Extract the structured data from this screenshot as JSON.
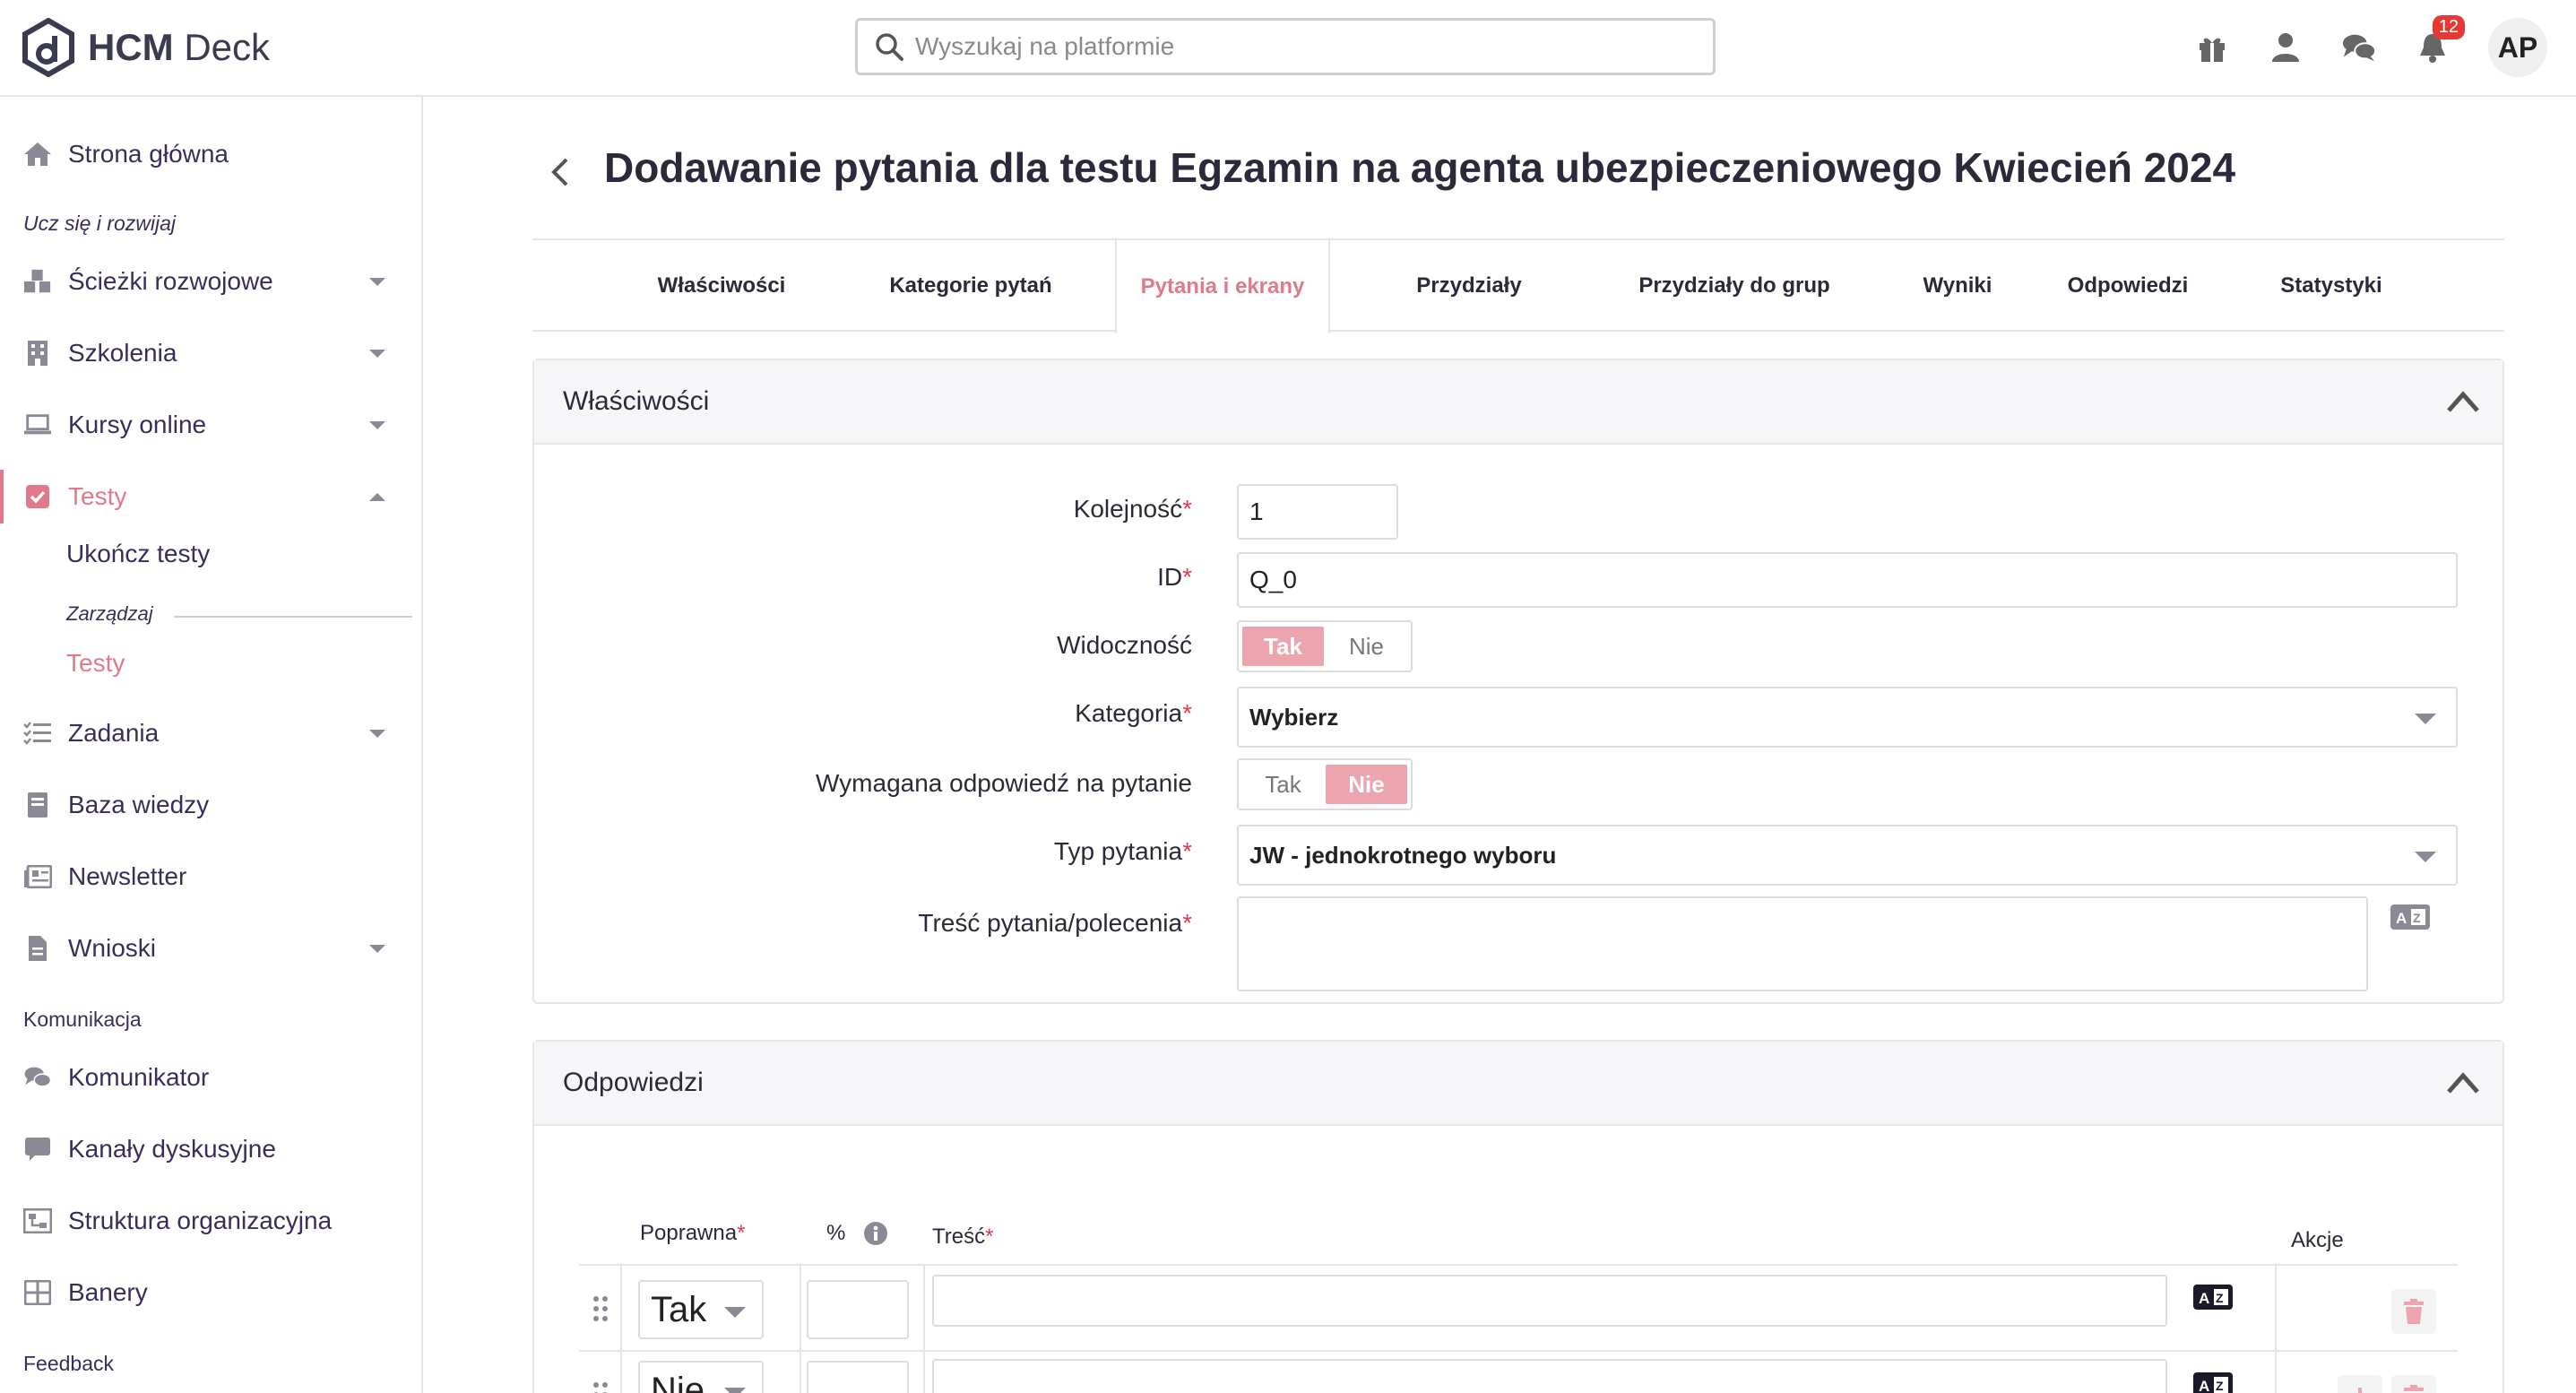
{
  "app": {
    "logo_text": "HCM",
    "logo_text2": "Deck"
  },
  "search": {
    "placeholder": "Wyszukaj na platformie"
  },
  "topbar": {
    "notifications_count": "12",
    "avatar_initials": "AP"
  },
  "sidebar": {
    "home": "Strona główna",
    "section_learn": "Ucz się i rozwijaj",
    "paths": "Ścieżki rozwojowe",
    "trainings": "Szkolenia",
    "courses": "Kursy online",
    "tests": "Testy",
    "tests_complete": "Ukończ testy",
    "tests_manage_label": "Zarządzaj",
    "tests_manage_item": "Testy",
    "tasks": "Zadania",
    "knowledge": "Baza wiedzy",
    "newsletter": "Newsletter",
    "requests": "Wnioski",
    "section_comm": "Komunikacja",
    "messenger": "Komunikator",
    "channels": "Kanały dyskusyjne",
    "org": "Struktura organizacyjna",
    "banners": "Banery",
    "section_feedback": "Feedback"
  },
  "page": {
    "title": "Dodawanie pytania dla testu Egzamin na agenta ubezpieczeniowego Kwiecień 2024"
  },
  "tabs": [
    "Właściwości",
    "Kategorie pytań",
    "Pytania i ekrany",
    "Przydziały",
    "Przydziały do grup",
    "Wyniki",
    "Odpowiedzi",
    "Statystyki"
  ],
  "props": {
    "title": "Właściwości",
    "order_label": "Kolejność",
    "order_value": "1",
    "id_label": "ID",
    "id_value": "Q_0",
    "visibility_label": "Widoczność",
    "visibility_yes": "Tak",
    "visibility_no": "Nie",
    "visibility_value": "Tak",
    "category_label": "Kategoria",
    "category_value": "Wybierz",
    "required_label": "Wymagana odpowiedź na pytanie",
    "required_yes": "Tak",
    "required_no": "Nie",
    "required_value": "Nie",
    "type_label": "Typ pytania",
    "type_value": "JW - jednokrotnego wyboru",
    "content_label": "Treść pytania/polecenia",
    "content_value": ""
  },
  "answers": {
    "title": "Odpowiedzi",
    "col_correct": "Poprawna",
    "col_percent": "%",
    "col_content": "Treść",
    "col_actions": "Akcje",
    "rows": [
      {
        "correct": "Tak",
        "percent": "",
        "content": ""
      },
      {
        "correct": "Nie",
        "percent": "",
        "content": ""
      }
    ]
  },
  "colors": {
    "accent": "#e07a8a",
    "toggle_on": "#eca4ae",
    "required": "#e53950",
    "badge": "#e53935"
  }
}
